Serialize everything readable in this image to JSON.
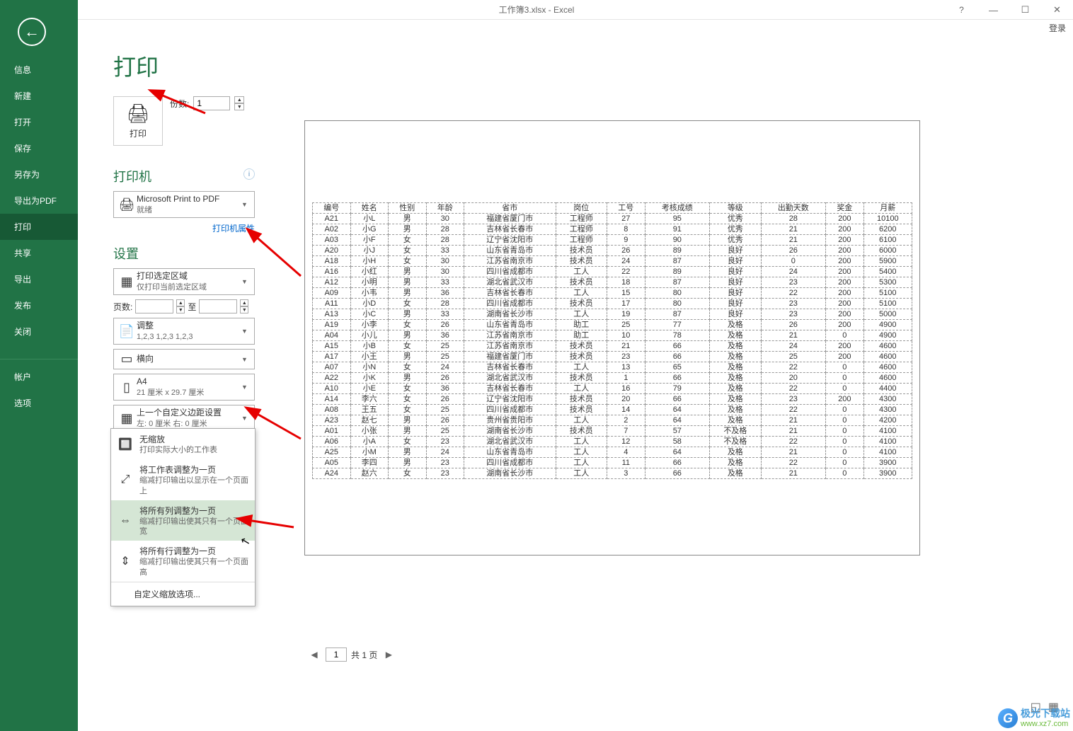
{
  "titlebar": {
    "title": "工作簿3.xlsx - Excel",
    "help": "?",
    "login": "登录"
  },
  "sidebar": {
    "items": [
      "信息",
      "新建",
      "打开",
      "保存",
      "另存为",
      "导出为PDF",
      "打印",
      "共享",
      "导出",
      "发布",
      "关闭"
    ],
    "bottom": [
      "帐户",
      "选项"
    ],
    "active_index": 6
  },
  "print_panel": {
    "title": "打印",
    "print_btn": "打印",
    "copies_label": "份数:",
    "copies_value": "1",
    "printer_section": "打印机",
    "printer_name": "Microsoft Print to PDF",
    "printer_status": "就绪",
    "printer_props": "打印机属性",
    "settings_section": "设置",
    "print_area": {
      "main": "打印选定区域",
      "sub": "仅打印当前选定区域"
    },
    "page_label": "页数:",
    "to_label": "至",
    "collate": {
      "main": "调整",
      "sub": "1,2,3   1,2,3   1,2,3"
    },
    "orientation": {
      "main": "横向"
    },
    "paper": {
      "main": "A4",
      "sub": "21 厘米 x 29.7 厘米"
    },
    "margins": {
      "main": "上一个自定义边距设置",
      "sub": "左: 0 厘米  右: 0 厘米"
    },
    "scaling": {
      "main": "将所有列调整为一页",
      "sub": "缩减打印输出使其只有一..."
    }
  },
  "popup": {
    "items": [
      {
        "main": "无缩放",
        "sub": "打印实际大小的工作表"
      },
      {
        "main": "将工作表调整为一页",
        "sub": "缩减打印输出以显示在一个页面上"
      },
      {
        "main": "将所有列调整为一页",
        "sub": "缩减打印输出使其只有一个页面宽"
      },
      {
        "main": "将所有行调整为一页",
        "sub": "缩减打印输出使其只有一个页面高"
      }
    ],
    "footer": "自定义缩放选项...",
    "hover_index": 2
  },
  "preview": {
    "columns": [
      "编号",
      "姓名",
      "性别",
      "年龄",
      "省市",
      "岗位",
      "工号",
      "考核成绩",
      "等级",
      "出勤天数",
      "奖金",
      "月薪"
    ],
    "rows": [
      [
        "A21",
        "小L",
        "男",
        "30",
        "福建省厦门市",
        "工程师",
        "27",
        "95",
        "优秀",
        "28",
        "200",
        "10100"
      ],
      [
        "A02",
        "小G",
        "男",
        "28",
        "吉林省长春市",
        "工程师",
        "8",
        "91",
        "优秀",
        "21",
        "200",
        "6200"
      ],
      [
        "A03",
        "小F",
        "女",
        "28",
        "辽宁省沈阳市",
        "工程师",
        "9",
        "90",
        "优秀",
        "21",
        "200",
        "6100"
      ],
      [
        "A20",
        "小J",
        "女",
        "33",
        "山东省青岛市",
        "技术员",
        "26",
        "89",
        "良好",
        "26",
        "200",
        "6000"
      ],
      [
        "A18",
        "小H",
        "女",
        "30",
        "江苏省南京市",
        "技术员",
        "24",
        "87",
        "良好",
        "0",
        "200",
        "5900"
      ],
      [
        "A16",
        "小红",
        "男",
        "30",
        "四川省成都市",
        "工人",
        "22",
        "89",
        "良好",
        "24",
        "200",
        "5400"
      ],
      [
        "A12",
        "小明",
        "男",
        "33",
        "湖北省武汉市",
        "技术员",
        "18",
        "87",
        "良好",
        "23",
        "200",
        "5300"
      ],
      [
        "A09",
        "小韦",
        "男",
        "36",
        "吉林省长春市",
        "工人",
        "15",
        "80",
        "良好",
        "22",
        "200",
        "5100"
      ],
      [
        "A11",
        "小D",
        "女",
        "28",
        "四川省成都市",
        "技术员",
        "17",
        "80",
        "良好",
        "23",
        "200",
        "5100"
      ],
      [
        "A13",
        "小C",
        "男",
        "33",
        "湖南省长沙市",
        "工人",
        "19",
        "87",
        "良好",
        "23",
        "200",
        "5000"
      ],
      [
        "A19",
        "小李",
        "女",
        "26",
        "山东省青岛市",
        "助工",
        "25",
        "77",
        "及格",
        "26",
        "200",
        "4900"
      ],
      [
        "A04",
        "小儿",
        "男",
        "36",
        "江苏省南京市",
        "助工",
        "10",
        "78",
        "及格",
        "21",
        "0",
        "4900"
      ],
      [
        "A15",
        "小B",
        "女",
        "25",
        "江苏省南京市",
        "技术员",
        "21",
        "66",
        "及格",
        "24",
        "200",
        "4600"
      ],
      [
        "A17",
        "小王",
        "男",
        "25",
        "福建省厦门市",
        "技术员",
        "23",
        "66",
        "及格",
        "25",
        "200",
        "4600"
      ],
      [
        "A07",
        "小N",
        "女",
        "24",
        "吉林省长春市",
        "工人",
        "13",
        "65",
        "及格",
        "22",
        "0",
        "4600"
      ],
      [
        "A22",
        "小K",
        "男",
        "26",
        "湖北省武汉市",
        "技术员",
        "1",
        "66",
        "及格",
        "20",
        "0",
        "4600"
      ],
      [
        "A10",
        "小E",
        "女",
        "36",
        "吉林省长春市",
        "工人",
        "16",
        "79",
        "及格",
        "22",
        "0",
        "4400"
      ],
      [
        "A14",
        "李六",
        "女",
        "26",
        "辽宁省沈阳市",
        "技术员",
        "20",
        "66",
        "及格",
        "23",
        "200",
        "4300"
      ],
      [
        "A08",
        "王五",
        "女",
        "25",
        "四川省成都市",
        "技术员",
        "14",
        "64",
        "及格",
        "22",
        "0",
        "4300"
      ],
      [
        "A23",
        "赵七",
        "男",
        "26",
        "贵州省贵阳市",
        "工人",
        "2",
        "64",
        "及格",
        "21",
        "0",
        "4200"
      ],
      [
        "A01",
        "小张",
        "男",
        "25",
        "湖南省长沙市",
        "技术员",
        "7",
        "57",
        "不及格",
        "21",
        "0",
        "4100"
      ],
      [
        "A06",
        "小A",
        "女",
        "23",
        "湖北省武汉市",
        "工人",
        "12",
        "58",
        "不及格",
        "22",
        "0",
        "4100"
      ],
      [
        "A25",
        "小M",
        "男",
        "24",
        "山东省青岛市",
        "工人",
        "4",
        "64",
        "及格",
        "21",
        "0",
        "4100"
      ],
      [
        "A05",
        "李四",
        "男",
        "23",
        "四川省成都市",
        "工人",
        "11",
        "66",
        "及格",
        "22",
        "0",
        "3900"
      ],
      [
        "A24",
        "赵六",
        "女",
        "23",
        "湖南省长沙市",
        "工人",
        "3",
        "66",
        "及格",
        "21",
        "0",
        "3900"
      ]
    ],
    "page_current": "1",
    "page_total": "共 1 页"
  },
  "watermark": {
    "l1": "极光下载站",
    "l2": "www.xz7.com"
  },
  "chart_data": null
}
